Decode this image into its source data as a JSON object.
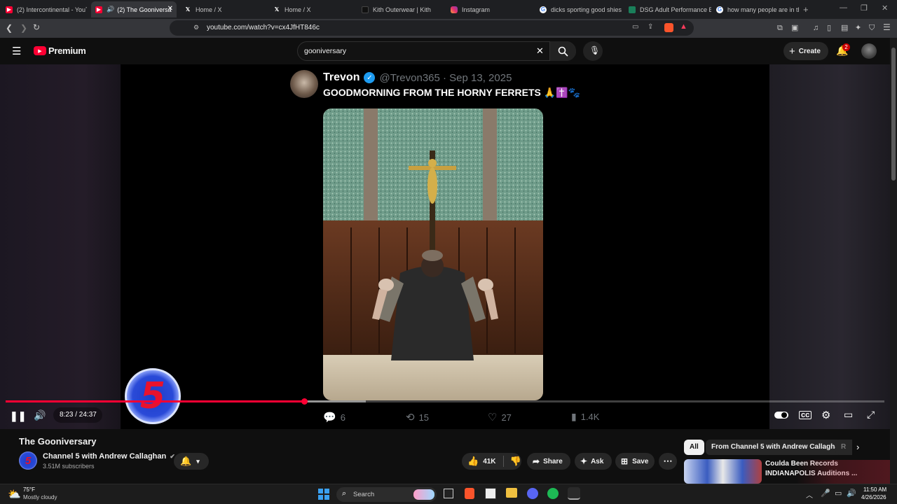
{
  "browser": {
    "tabs": [
      {
        "label": "(2) Intercontinental - YouT",
        "icon": "youtube-icon"
      },
      {
        "label": "(2) The Gooniversa",
        "icon": "youtube-icon",
        "active": true
      },
      {
        "label": "Home / X",
        "icon": "x-icon"
      },
      {
        "label": "Home / X",
        "icon": "x-icon"
      },
      {
        "label": "Kith Outerwear | Kith",
        "icon": "kith-icon"
      },
      {
        "label": "Instagram",
        "icon": "instagram-icon"
      },
      {
        "label": "dicks sporting good shies",
        "icon": "google-icon"
      },
      {
        "label": "DSG Adult Performance B",
        "icon": "dsg-icon"
      },
      {
        "label": "how many people are in th",
        "icon": "google-icon"
      }
    ],
    "url": "youtube.com/watch?v=cx4JfHT846c",
    "colors": {
      "accent": "#ff0033",
      "bg": "#0f0f0f"
    }
  },
  "yt": {
    "logo_text": "Premium",
    "search_value": "gooniversary",
    "create_label": "Create",
    "notif_count": "2"
  },
  "tweet": {
    "name": "Trevon",
    "handle": "@Trevon365 · Sep 13, 2025",
    "text": "GOODMORNING FROM THE HORNY FERRETS 🙏✝️🐾",
    "replies": "6",
    "retweets": "15",
    "likes": "27",
    "views": "1.4K"
  },
  "player": {
    "time": "8:23 / 24:37",
    "progress": 0.34,
    "buffered": 0.41,
    "logo_text": "5"
  },
  "video": {
    "title": "The Gooniversary",
    "channel": "Channel 5 with Andrew Callaghan",
    "subscribers": "3.51M subscribers",
    "likes": "41K",
    "share_label": "Share",
    "ask_label": "Ask",
    "save_label": "Save"
  },
  "related": {
    "chips": [
      "All",
      "From Channel 5 with Andrew Callaghan",
      "R"
    ],
    "first_title_line1": "Coulda Been Records",
    "first_title_line2": "INDIANAPOLIS Auditions ..."
  },
  "taskbar": {
    "weather_temp": "75°F",
    "weather_desc": "Mostly cloudy",
    "search_label": "Search",
    "time": "11:50 AM",
    "date": "4/26/2026"
  }
}
